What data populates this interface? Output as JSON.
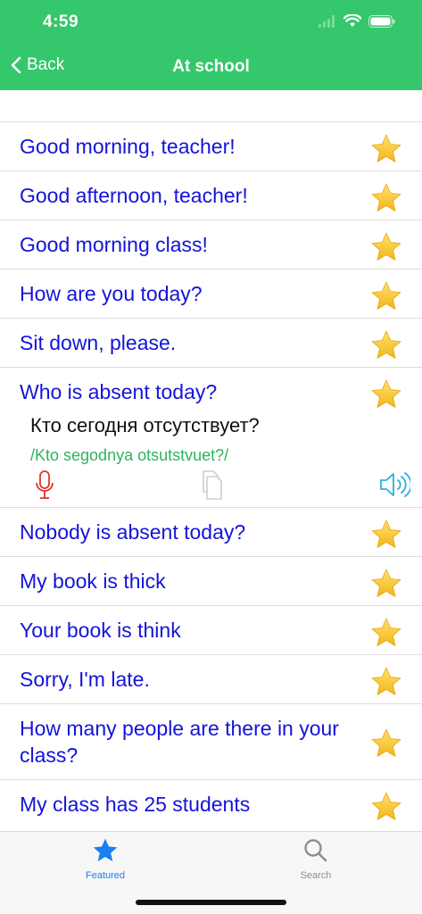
{
  "status": {
    "time": "4:59"
  },
  "nav": {
    "back_label": "Back",
    "title": "At school"
  },
  "colors": {
    "header": "#35c76b",
    "phrase": "#1414d9",
    "translit": "#2fb35c",
    "tab_active": "#1a7ff0",
    "tab_inactive": "#8e8e93"
  },
  "phrases": [
    {
      "text": "Good morning, teacher!"
    },
    {
      "text": "Good afternoon, teacher!"
    },
    {
      "text": "Good morning class!"
    },
    {
      "text": "How are you today?"
    },
    {
      "text": "Sit down, please."
    },
    {
      "text": "Who is absent today?",
      "translation": "Кто сегодня отсутствует?",
      "transliteration": "/Kto segodnya otsutstvuet?/"
    },
    {
      "text": "Nobody is absent today?"
    },
    {
      "text": "My book is thick"
    },
    {
      "text": "Your book is think"
    },
    {
      "text": "Sorry, I'm late."
    },
    {
      "text": "How many people are there in your class?"
    },
    {
      "text": "My class has 25 students"
    }
  ],
  "tabs": {
    "featured": "Featured",
    "search": "Search"
  }
}
